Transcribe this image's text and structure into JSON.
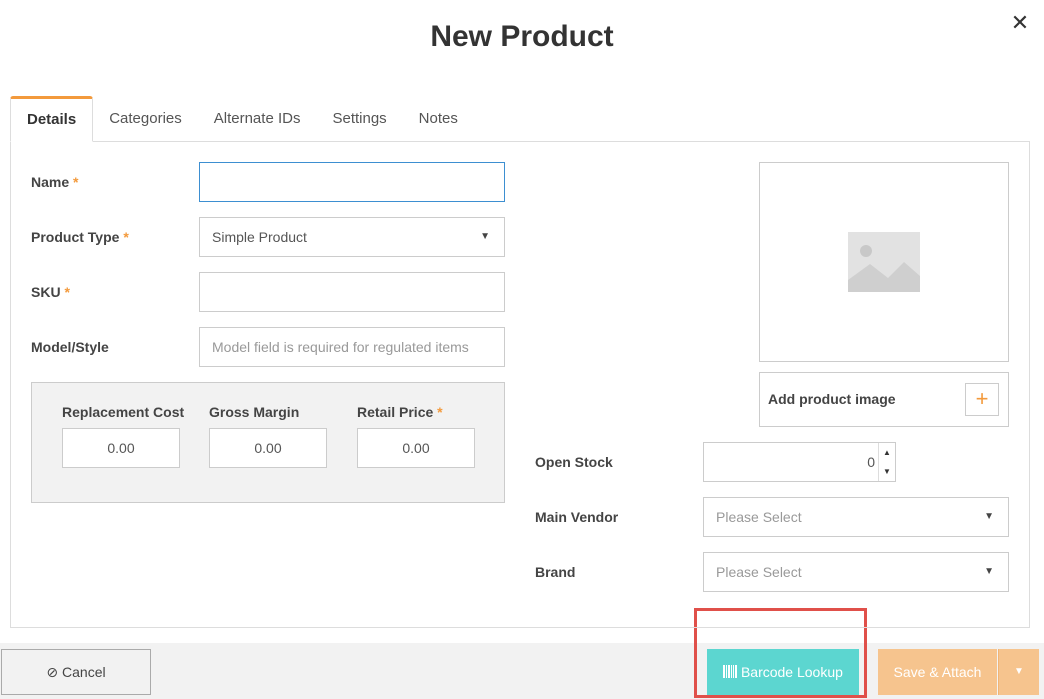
{
  "header": {
    "title": "New Product",
    "close_icon": "close-icon"
  },
  "tabs": [
    {
      "label": "Details",
      "active": true
    },
    {
      "label": "Categories"
    },
    {
      "label": "Alternate IDs"
    },
    {
      "label": "Settings"
    },
    {
      "label": "Notes"
    }
  ],
  "form": {
    "name": {
      "label": "Name",
      "required": "*",
      "value": ""
    },
    "product_type": {
      "label": "Product Type",
      "required": "*",
      "value": "Simple Product"
    },
    "sku": {
      "label": "SKU",
      "required": "*",
      "value": ""
    },
    "model": {
      "label": "Model/Style",
      "placeholder": "Model field is required for regulated items"
    },
    "pricing": {
      "replacement_cost": {
        "label": "Replacement Cost",
        "value": "0.00"
      },
      "gross_margin": {
        "label": "Gross Margin",
        "value": "0.00"
      },
      "retail_price": {
        "label": "Retail Price",
        "required": "*",
        "value": "0.00"
      }
    },
    "open_stock": {
      "label": "Open Stock",
      "value": "0"
    },
    "main_vendor": {
      "label": "Main Vendor",
      "value": "Please Select"
    },
    "brand": {
      "label": "Brand",
      "value": "Please Select"
    }
  },
  "image": {
    "add_label": "Add product image",
    "plus": "+"
  },
  "footer": {
    "cancel_label": "Cancel",
    "barcode_label": "Barcode Lookup",
    "save_label": "Save & Attach"
  },
  "colors": {
    "accent": "#f39a3c",
    "barcode": "#5cd6d0",
    "save": "#f6c48e",
    "highlight": "#e0504a"
  }
}
